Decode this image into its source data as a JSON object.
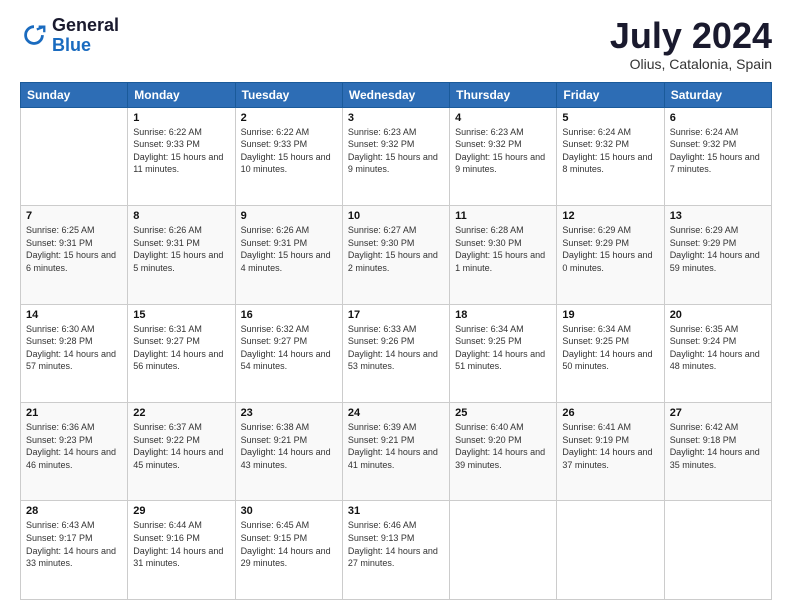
{
  "logo": {
    "text_general": "General",
    "text_blue": "Blue"
  },
  "header": {
    "title": "July 2024",
    "subtitle": "Olius, Catalonia, Spain"
  },
  "weekdays": [
    "Sunday",
    "Monday",
    "Tuesday",
    "Wednesday",
    "Thursday",
    "Friday",
    "Saturday"
  ],
  "weeks": [
    [
      {
        "day": "",
        "sunrise": "",
        "sunset": "",
        "daylight": ""
      },
      {
        "day": "1",
        "sunrise": "Sunrise: 6:22 AM",
        "sunset": "Sunset: 9:33 PM",
        "daylight": "Daylight: 15 hours and 11 minutes."
      },
      {
        "day": "2",
        "sunrise": "Sunrise: 6:22 AM",
        "sunset": "Sunset: 9:33 PM",
        "daylight": "Daylight: 15 hours and 10 minutes."
      },
      {
        "day": "3",
        "sunrise": "Sunrise: 6:23 AM",
        "sunset": "Sunset: 9:32 PM",
        "daylight": "Daylight: 15 hours and 9 minutes."
      },
      {
        "day": "4",
        "sunrise": "Sunrise: 6:23 AM",
        "sunset": "Sunset: 9:32 PM",
        "daylight": "Daylight: 15 hours and 9 minutes."
      },
      {
        "day": "5",
        "sunrise": "Sunrise: 6:24 AM",
        "sunset": "Sunset: 9:32 PM",
        "daylight": "Daylight: 15 hours and 8 minutes."
      },
      {
        "day": "6",
        "sunrise": "Sunrise: 6:24 AM",
        "sunset": "Sunset: 9:32 PM",
        "daylight": "Daylight: 15 hours and 7 minutes."
      }
    ],
    [
      {
        "day": "7",
        "sunrise": "Sunrise: 6:25 AM",
        "sunset": "Sunset: 9:31 PM",
        "daylight": "Daylight: 15 hours and 6 minutes."
      },
      {
        "day": "8",
        "sunrise": "Sunrise: 6:26 AM",
        "sunset": "Sunset: 9:31 PM",
        "daylight": "Daylight: 15 hours and 5 minutes."
      },
      {
        "day": "9",
        "sunrise": "Sunrise: 6:26 AM",
        "sunset": "Sunset: 9:31 PM",
        "daylight": "Daylight: 15 hours and 4 minutes."
      },
      {
        "day": "10",
        "sunrise": "Sunrise: 6:27 AM",
        "sunset": "Sunset: 9:30 PM",
        "daylight": "Daylight: 15 hours and 2 minutes."
      },
      {
        "day": "11",
        "sunrise": "Sunrise: 6:28 AM",
        "sunset": "Sunset: 9:30 PM",
        "daylight": "Daylight: 15 hours and 1 minute."
      },
      {
        "day": "12",
        "sunrise": "Sunrise: 6:29 AM",
        "sunset": "Sunset: 9:29 PM",
        "daylight": "Daylight: 15 hours and 0 minutes."
      },
      {
        "day": "13",
        "sunrise": "Sunrise: 6:29 AM",
        "sunset": "Sunset: 9:29 PM",
        "daylight": "Daylight: 14 hours and 59 minutes."
      }
    ],
    [
      {
        "day": "14",
        "sunrise": "Sunrise: 6:30 AM",
        "sunset": "Sunset: 9:28 PM",
        "daylight": "Daylight: 14 hours and 57 minutes."
      },
      {
        "day": "15",
        "sunrise": "Sunrise: 6:31 AM",
        "sunset": "Sunset: 9:27 PM",
        "daylight": "Daylight: 14 hours and 56 minutes."
      },
      {
        "day": "16",
        "sunrise": "Sunrise: 6:32 AM",
        "sunset": "Sunset: 9:27 PM",
        "daylight": "Daylight: 14 hours and 54 minutes."
      },
      {
        "day": "17",
        "sunrise": "Sunrise: 6:33 AM",
        "sunset": "Sunset: 9:26 PM",
        "daylight": "Daylight: 14 hours and 53 minutes."
      },
      {
        "day": "18",
        "sunrise": "Sunrise: 6:34 AM",
        "sunset": "Sunset: 9:25 PM",
        "daylight": "Daylight: 14 hours and 51 minutes."
      },
      {
        "day": "19",
        "sunrise": "Sunrise: 6:34 AM",
        "sunset": "Sunset: 9:25 PM",
        "daylight": "Daylight: 14 hours and 50 minutes."
      },
      {
        "day": "20",
        "sunrise": "Sunrise: 6:35 AM",
        "sunset": "Sunset: 9:24 PM",
        "daylight": "Daylight: 14 hours and 48 minutes."
      }
    ],
    [
      {
        "day": "21",
        "sunrise": "Sunrise: 6:36 AM",
        "sunset": "Sunset: 9:23 PM",
        "daylight": "Daylight: 14 hours and 46 minutes."
      },
      {
        "day": "22",
        "sunrise": "Sunrise: 6:37 AM",
        "sunset": "Sunset: 9:22 PM",
        "daylight": "Daylight: 14 hours and 45 minutes."
      },
      {
        "day": "23",
        "sunrise": "Sunrise: 6:38 AM",
        "sunset": "Sunset: 9:21 PM",
        "daylight": "Daylight: 14 hours and 43 minutes."
      },
      {
        "day": "24",
        "sunrise": "Sunrise: 6:39 AM",
        "sunset": "Sunset: 9:21 PM",
        "daylight": "Daylight: 14 hours and 41 minutes."
      },
      {
        "day": "25",
        "sunrise": "Sunrise: 6:40 AM",
        "sunset": "Sunset: 9:20 PM",
        "daylight": "Daylight: 14 hours and 39 minutes."
      },
      {
        "day": "26",
        "sunrise": "Sunrise: 6:41 AM",
        "sunset": "Sunset: 9:19 PM",
        "daylight": "Daylight: 14 hours and 37 minutes."
      },
      {
        "day": "27",
        "sunrise": "Sunrise: 6:42 AM",
        "sunset": "Sunset: 9:18 PM",
        "daylight": "Daylight: 14 hours and 35 minutes."
      }
    ],
    [
      {
        "day": "28",
        "sunrise": "Sunrise: 6:43 AM",
        "sunset": "Sunset: 9:17 PM",
        "daylight": "Daylight: 14 hours and 33 minutes."
      },
      {
        "day": "29",
        "sunrise": "Sunrise: 6:44 AM",
        "sunset": "Sunset: 9:16 PM",
        "daylight": "Daylight: 14 hours and 31 minutes."
      },
      {
        "day": "30",
        "sunrise": "Sunrise: 6:45 AM",
        "sunset": "Sunset: 9:15 PM",
        "daylight": "Daylight: 14 hours and 29 minutes."
      },
      {
        "day": "31",
        "sunrise": "Sunrise: 6:46 AM",
        "sunset": "Sunset: 9:13 PM",
        "daylight": "Daylight: 14 hours and 27 minutes."
      },
      {
        "day": "",
        "sunrise": "",
        "sunset": "",
        "daylight": ""
      },
      {
        "day": "",
        "sunrise": "",
        "sunset": "",
        "daylight": ""
      },
      {
        "day": "",
        "sunrise": "",
        "sunset": "",
        "daylight": ""
      }
    ]
  ]
}
